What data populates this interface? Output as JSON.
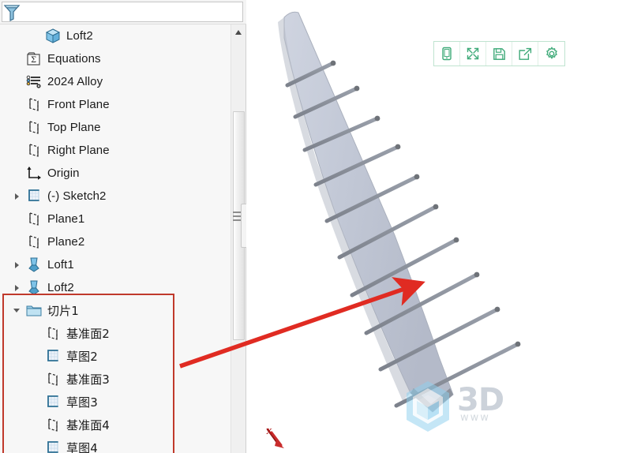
{
  "app": {
    "accent_green": "#3faa79",
    "annotation_red": "#c0392b",
    "model_face": "#c2c8d6",
    "model_edge": "#6e7278",
    "panel_bg": "#f7f7f7"
  },
  "filter_bar": {
    "icon": "filter-funnel-icon",
    "placeholder": "",
    "value": ""
  },
  "tree": {
    "items": [
      {
        "label": "Loft2",
        "icon": "solid-body-icon",
        "indent": 2,
        "twisty": "none",
        "cjk": false
      },
      {
        "label": "Equations",
        "icon": "equations-icon",
        "indent": 1,
        "twisty": "none",
        "cjk": false
      },
      {
        "label": "2024 Alloy",
        "icon": "material-icon",
        "indent": 1,
        "twisty": "none",
        "cjk": false
      },
      {
        "label": "Front Plane",
        "icon": "plane-icon",
        "indent": 1,
        "twisty": "none",
        "cjk": false
      },
      {
        "label": "Top Plane",
        "icon": "plane-icon",
        "indent": 1,
        "twisty": "none",
        "cjk": false
      },
      {
        "label": "Right Plane",
        "icon": "plane-icon",
        "indent": 1,
        "twisty": "none",
        "cjk": false
      },
      {
        "label": "Origin",
        "icon": "origin-icon",
        "indent": 1,
        "twisty": "none",
        "cjk": false
      },
      {
        "label": "(-) Sketch2",
        "icon": "sketch-icon",
        "indent": 1,
        "twisty": "collapsed",
        "cjk": false
      },
      {
        "label": "Plane1",
        "icon": "plane-icon",
        "indent": 1,
        "twisty": "none",
        "cjk": false
      },
      {
        "label": "Plane2",
        "icon": "plane-icon",
        "indent": 1,
        "twisty": "none",
        "cjk": false
      },
      {
        "label": "Loft1",
        "icon": "loft-feature-icon",
        "indent": 1,
        "twisty": "collapsed",
        "cjk": false
      },
      {
        "label": "Loft2",
        "icon": "loft-feature-icon",
        "indent": 1,
        "twisty": "collapsed",
        "cjk": false
      },
      {
        "label": "切片1",
        "icon": "folder-icon",
        "indent": 1,
        "twisty": "expanded",
        "cjk": true
      },
      {
        "label": "基准面2",
        "icon": "plane-icon",
        "indent": 2,
        "twisty": "none",
        "cjk": true
      },
      {
        "label": "草图2",
        "icon": "sketch-icon",
        "indent": 2,
        "twisty": "none",
        "cjk": true
      },
      {
        "label": "基准面3",
        "icon": "plane-icon",
        "indent": 2,
        "twisty": "none",
        "cjk": true
      },
      {
        "label": "草图3",
        "icon": "sketch-icon",
        "indent": 2,
        "twisty": "none",
        "cjk": true
      },
      {
        "label": "基准面4",
        "icon": "plane-icon",
        "indent": 2,
        "twisty": "none",
        "cjk": true
      },
      {
        "label": "草图4",
        "icon": "sketch-icon",
        "indent": 2,
        "twisty": "none",
        "cjk": true
      }
    ]
  },
  "annotation": {
    "highlight_box_label": "切片1 feature group highlight",
    "arrow_label": "pointer from 切片1 group to sliced model"
  },
  "scrollbar": {
    "up_arrow": "scroll-up-arrow-icon",
    "thumb_label": "vertical-scroll-thumb"
  },
  "splitter": {
    "label": "panel-splitter-handle"
  },
  "viewport_toolbar": {
    "buttons": [
      {
        "icon": "mobile-view-icon",
        "label": "Mobile view"
      },
      {
        "icon": "fullscreen-icon",
        "label": "Fullscreen"
      },
      {
        "icon": "save-icon",
        "label": "Save"
      },
      {
        "icon": "share-export-icon",
        "label": "Share"
      },
      {
        "icon": "gear-icon",
        "label": "Settings"
      }
    ]
  },
  "viewport": {
    "axis_label": "X",
    "axis_icon": "axis-triad-icon",
    "model_label": "sliced-loft-blade-model",
    "slice_count": 10
  },
  "watermark": {
    "logo_icon": "hex-cube-logo-icon",
    "text": "3D",
    "sub": "www"
  }
}
